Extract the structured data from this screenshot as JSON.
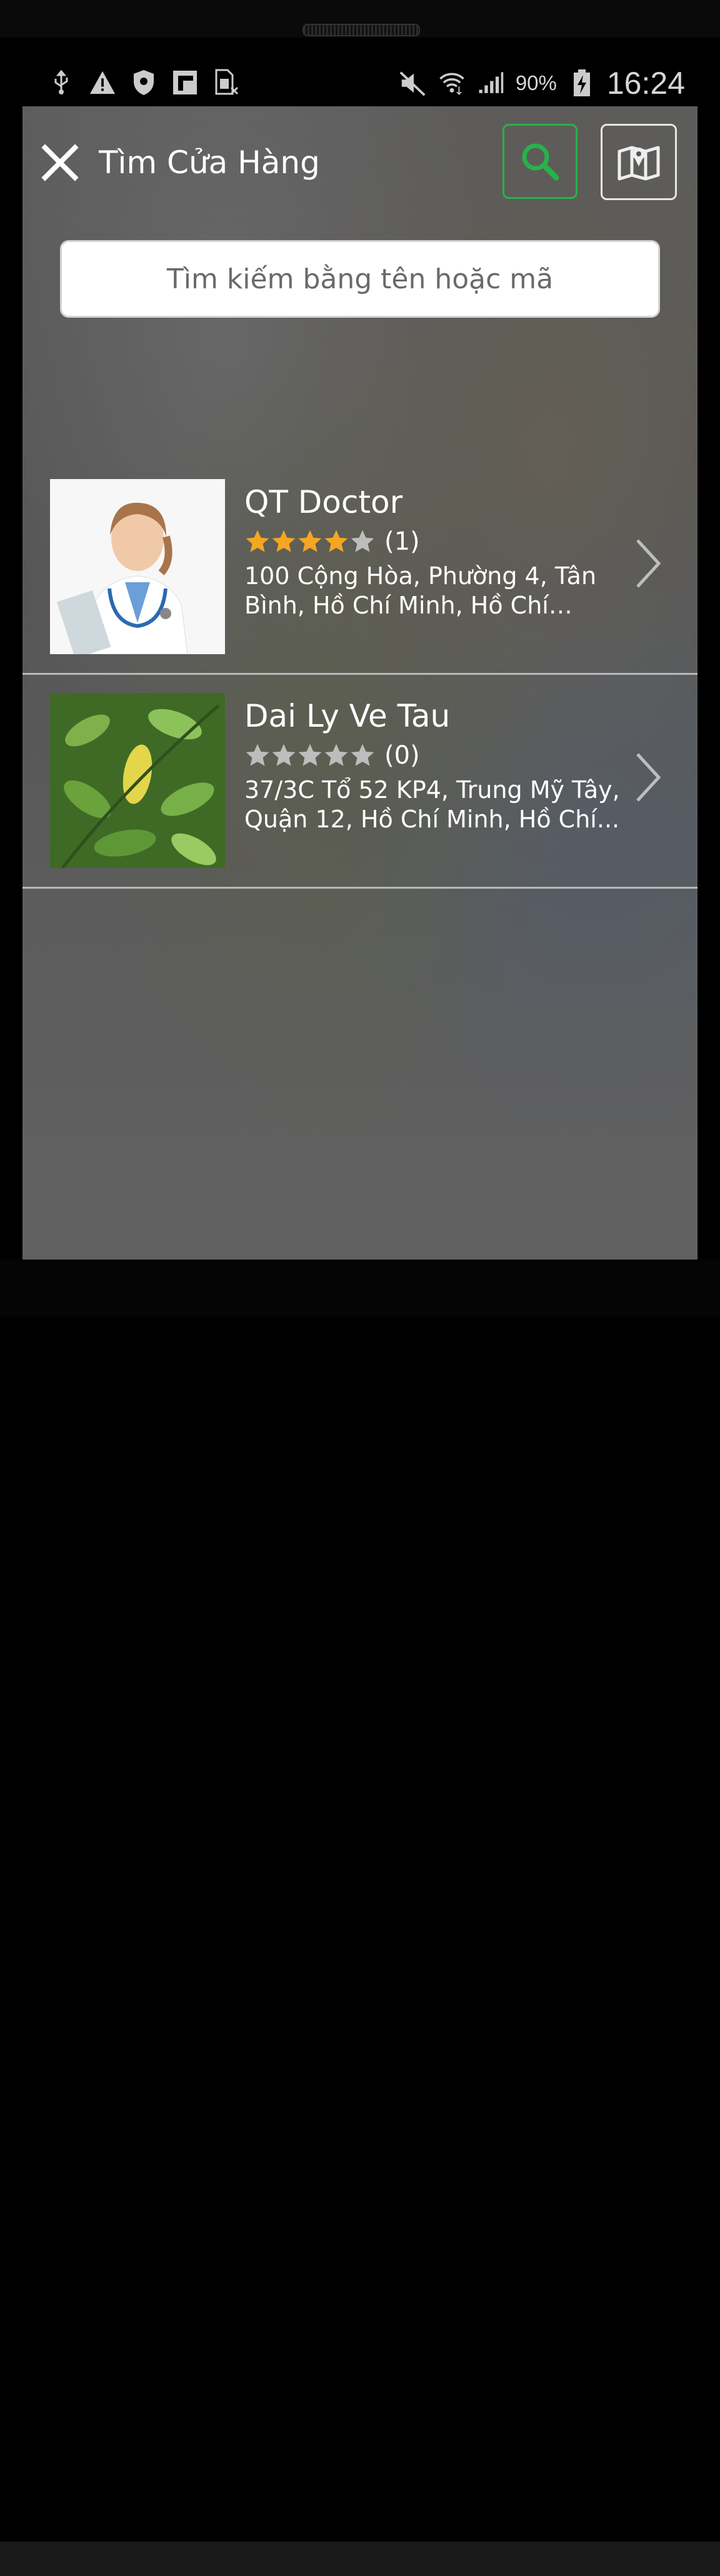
{
  "status_bar": {
    "battery_percent": "90%",
    "time": "16:24",
    "icons_left": [
      "usb-icon",
      "warning-icon",
      "shield-icon",
      "flipboard-icon",
      "sim-off-icon"
    ],
    "icons_right": [
      "mute-icon",
      "wifi-icon",
      "signal-icon",
      "battery-charging-icon"
    ]
  },
  "header": {
    "title": "Tìm Cửa Hàng",
    "search_accent": "#27b24a"
  },
  "search": {
    "placeholder": "Tìm kiếm bằng tên hoặc mã"
  },
  "stores": [
    {
      "name": "QT Doctor",
      "rating": 4,
      "rating_max": 5,
      "review_count": "(1)",
      "address": "100 Cộng Hòa, Phường 4, Tân Bình, Hồ Chí Minh, Hồ Chí Minh...",
      "thumbnail": "doctor-photo"
    },
    {
      "name": "Dai Ly Ve Tau",
      "rating": 0,
      "rating_max": 5,
      "review_count": "(0)",
      "address": "37/3C Tổ 52 KP4, Trung Mỹ Tây, Quận 12, Hồ Chí Minh, Hồ Chí...",
      "thumbnail": "leaves-photo"
    }
  ],
  "colors": {
    "star_filled": "#f5a623",
    "star_empty": "#bdbdbd"
  }
}
